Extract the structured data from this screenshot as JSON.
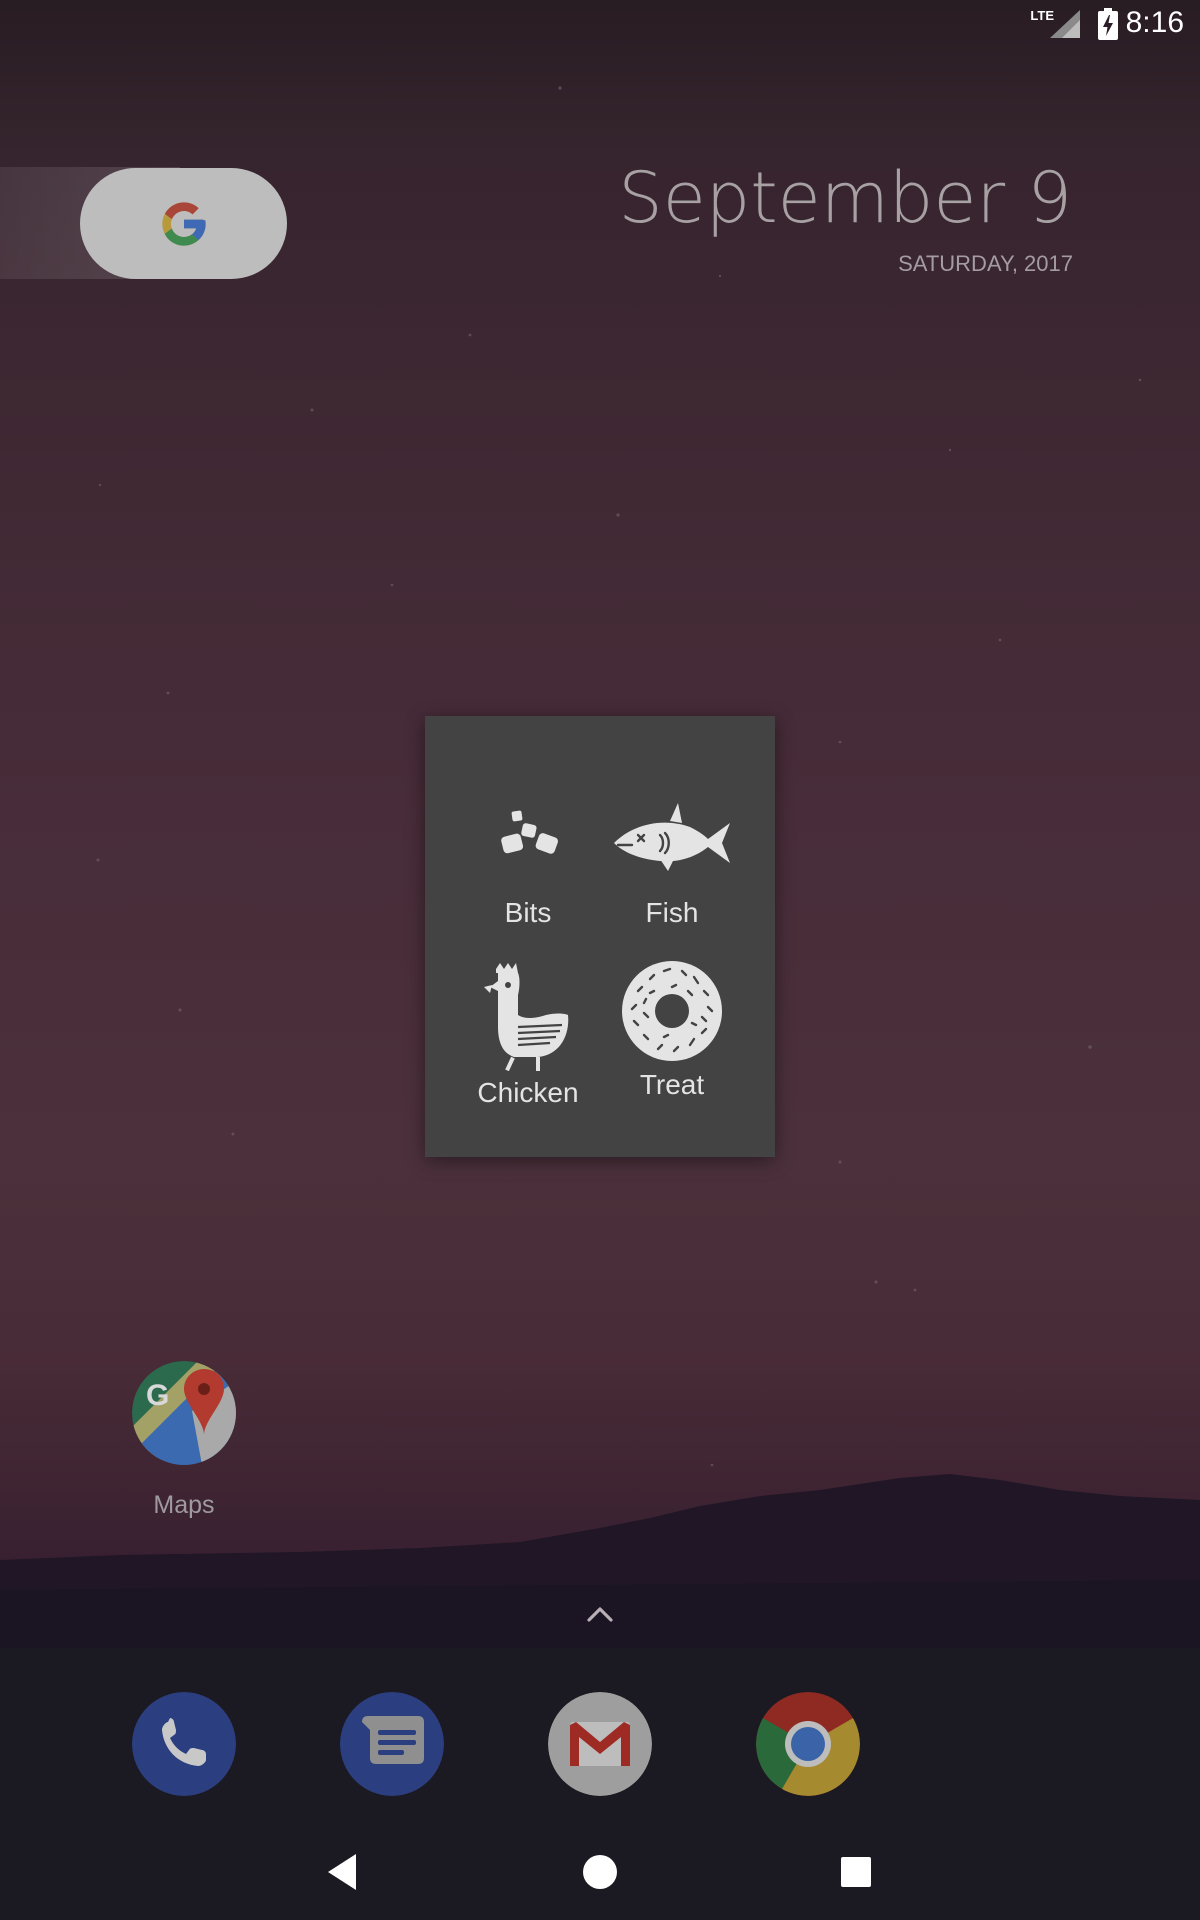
{
  "status_bar": {
    "network": "LTE",
    "time": "8:16"
  },
  "search_widget": {
    "icon": "google-g-icon"
  },
  "date_widget": {
    "date": "September 9",
    "weekday_year": "SATURDAY, 2017"
  },
  "food_menu": {
    "items": [
      {
        "label": "Bits",
        "icon": "bits-icon"
      },
      {
        "label": "Fish",
        "icon": "fish-icon"
      },
      {
        "label": "Chicken",
        "icon": "chicken-icon"
      },
      {
        "label": "Treat",
        "icon": "donut-icon"
      }
    ],
    "background": "#434343",
    "icon_color": "#e4e4e4"
  },
  "home_apps": [
    {
      "label": "Maps",
      "icon": "google-maps-icon"
    }
  ],
  "dock": {
    "apps": [
      {
        "name": "Phone",
        "icon": "phone-icon"
      },
      {
        "name": "Messages",
        "icon": "messages-icon"
      },
      {
        "name": "Gmail",
        "icon": "gmail-icon"
      },
      {
        "name": "Chrome",
        "icon": "chrome-icon"
      }
    ]
  },
  "nav_bar": {
    "buttons": [
      "back-icon",
      "home-icon",
      "recents-icon"
    ]
  }
}
